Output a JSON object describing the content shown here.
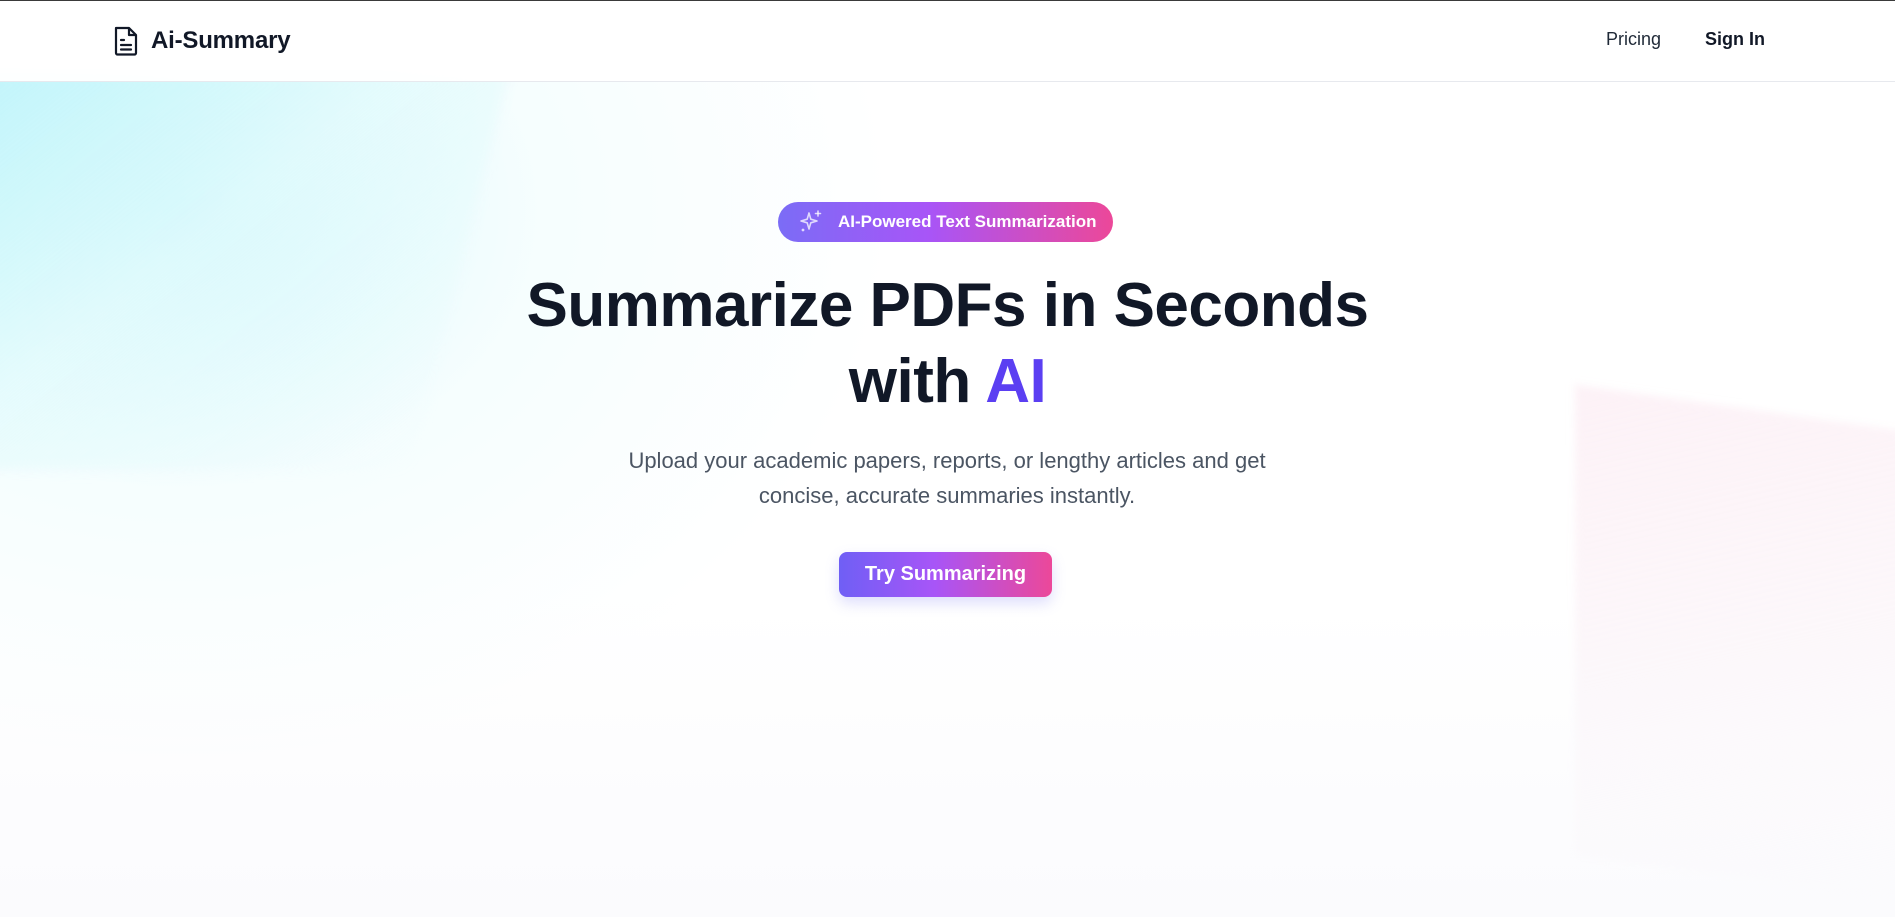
{
  "header": {
    "brand_name": "Ai-Summary",
    "brand_icon": "document-icon",
    "nav": {
      "pricing_label": "Pricing",
      "signin_label": "Sign In"
    }
  },
  "hero": {
    "badge": {
      "icon": "sparkle-icon",
      "label": "AI-Powered Text Summarization"
    },
    "headline_line1": "Summarize PDFs in Seconds",
    "headline_line2_prefix": "with ",
    "headline_accent": "AI",
    "subtext": "Upload your academic papers, reports, or lengthy articles and get concise, accurate summaries instantly.",
    "cta_label": "Try Summarizing"
  },
  "colors": {
    "accent_text": "#5b3ff2",
    "gradient_start": "#7b6cf6",
    "gradient_end": "#ec4899",
    "heading": "#111827",
    "body_text": "#4b5563"
  }
}
